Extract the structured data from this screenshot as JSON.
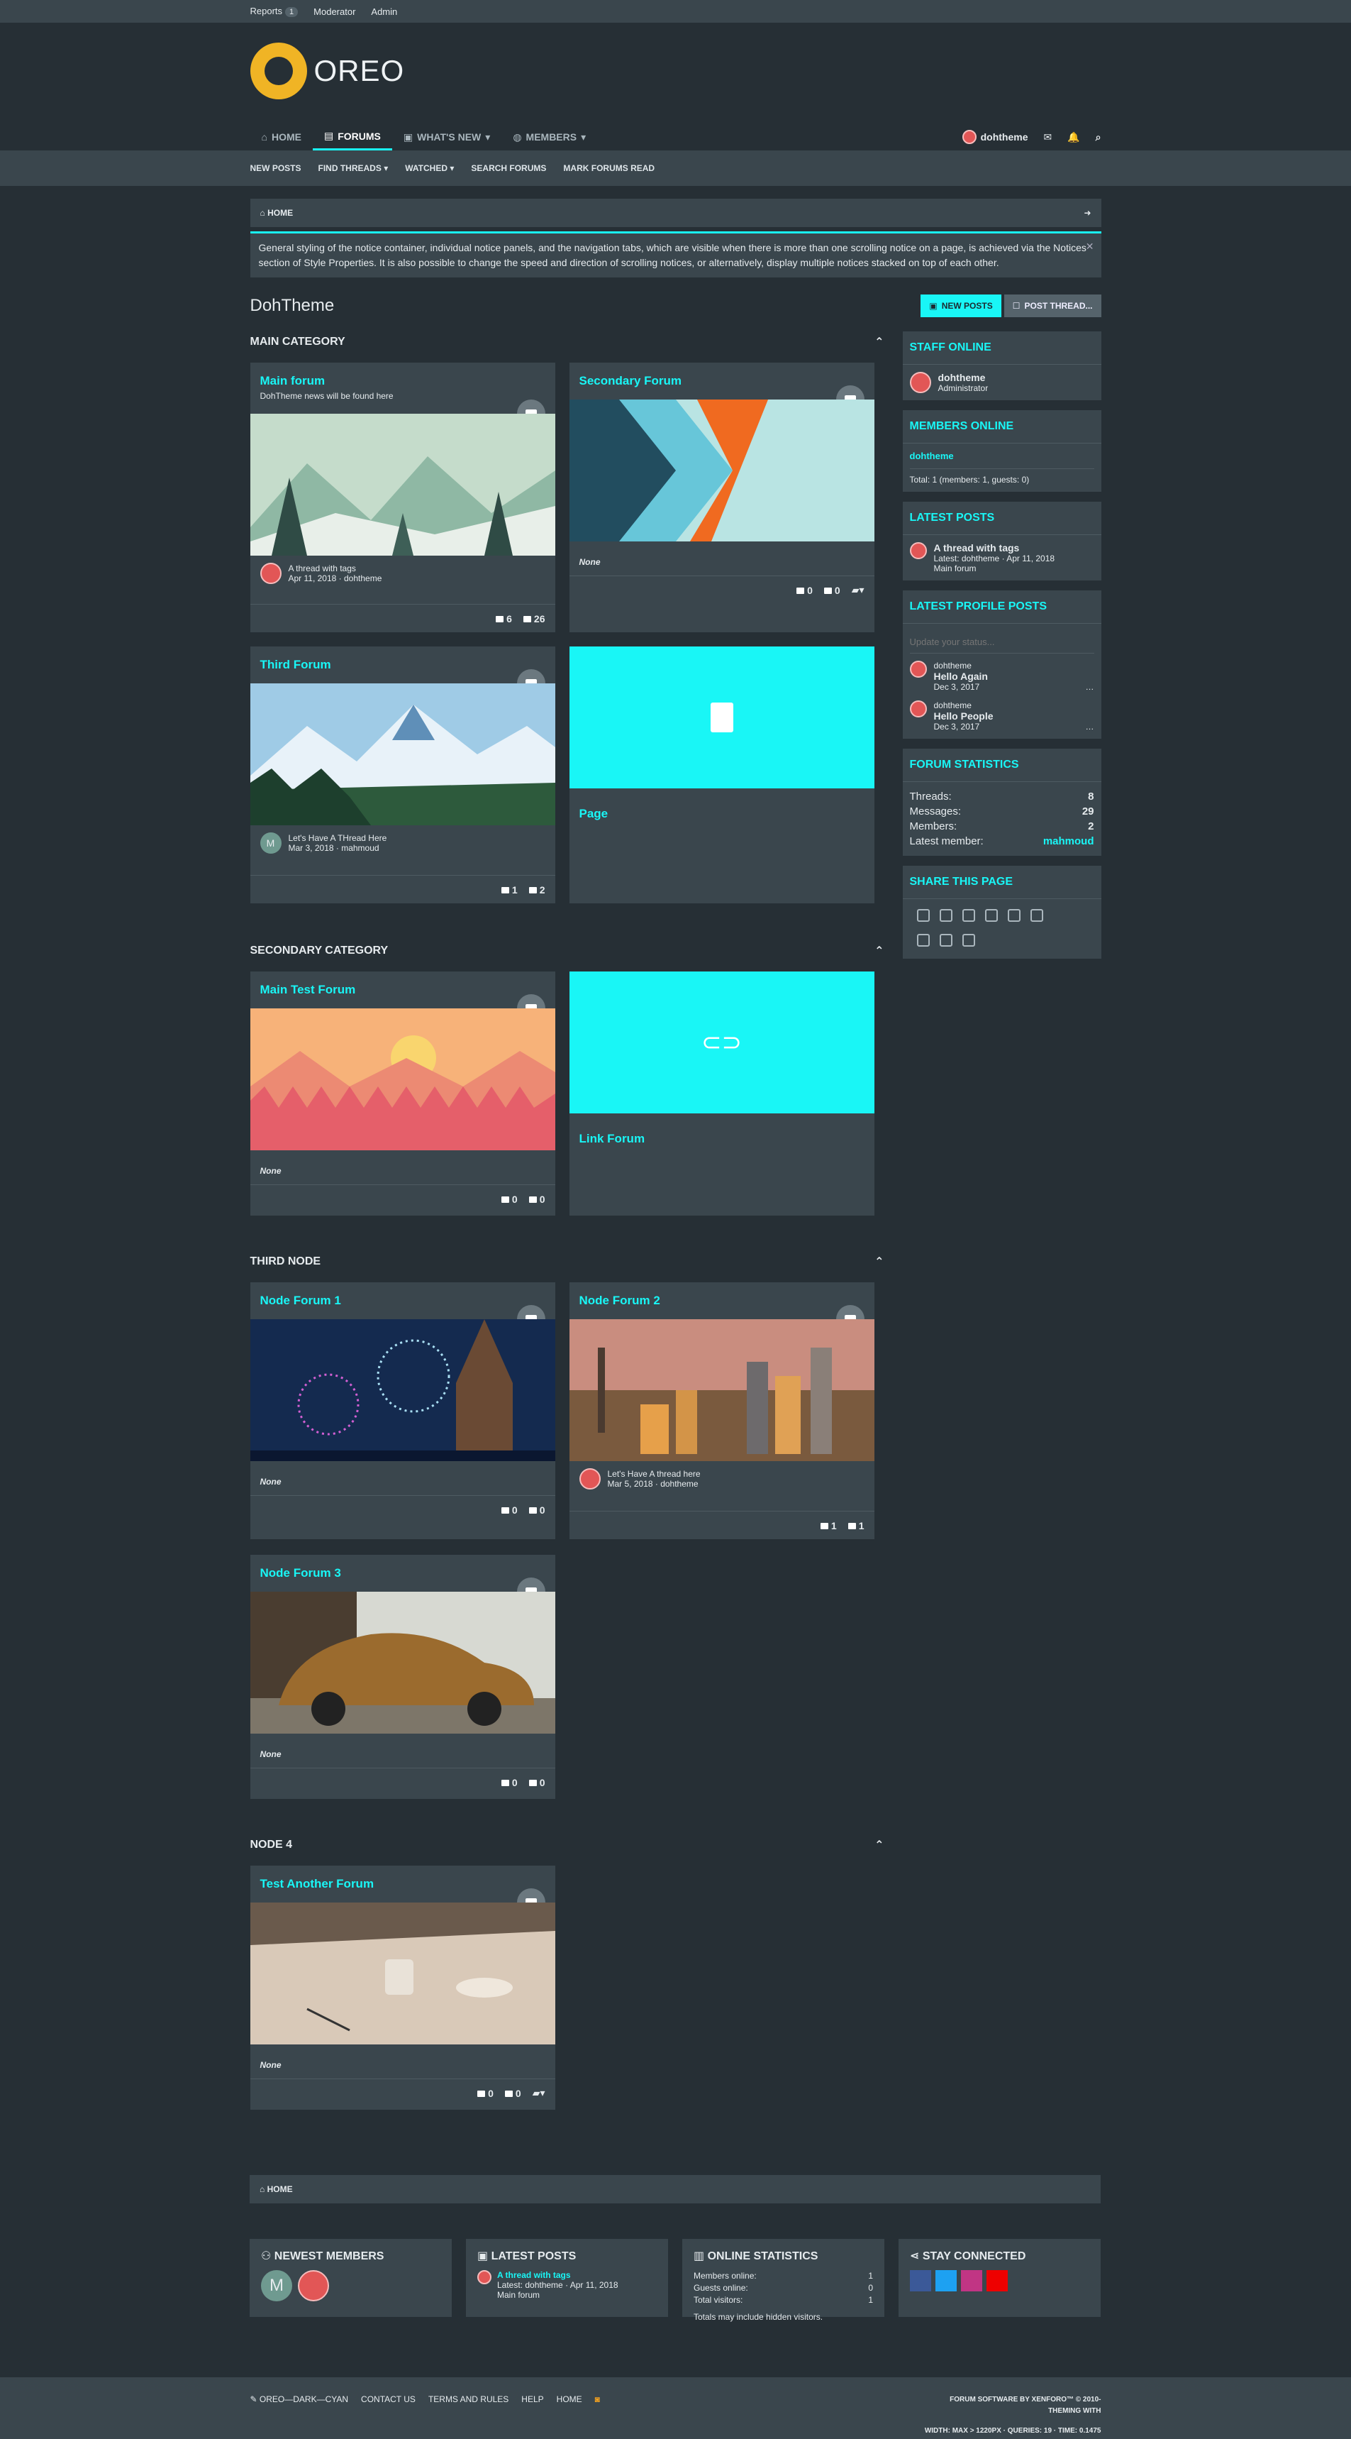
{
  "staffbar": {
    "reports": "Reports",
    "reports_count": "1",
    "moderator": "Moderator",
    "admin": "Admin"
  },
  "brand": {
    "name": "OREO"
  },
  "nav": {
    "home": "HOME",
    "forums": "FORUMS",
    "whats_new": "WHAT'S NEW",
    "members": "MEMBERS",
    "user": "dohtheme"
  },
  "subnav": {
    "new_posts": "NEW POSTS",
    "find_threads": "FIND THREADS",
    "watched": "WATCHED",
    "search_forums": "SEARCH FORUMS",
    "mark_read": "MARK FORUMS READ"
  },
  "breadcrumb": {
    "home": "HOME"
  },
  "notice": {
    "text": "General styling of the notice container, individual notice panels, and the navigation tabs, which are visible when there is more than one scrolling notice on a page, is achieved via the Notices section of Style Properties. It is also possible to change the speed and direction of scrolling notices, or alternatively, display multiple notices stacked on top of each other."
  },
  "page": {
    "title": "DohTheme",
    "new_posts": "NEW POSTS",
    "post_thread": "POST THREAD..."
  },
  "categories": {
    "main": "MAIN CATEGORY",
    "secondary": "SECONDARY CATEGORY",
    "third": "THIRD NODE",
    "node4": "NODE 4"
  },
  "forums": {
    "main_forum": {
      "title": "Main forum",
      "desc": "DohTheme news will be found here",
      "latest_title": "A thread with tags",
      "latest_meta": "Apr 11, 2018 · dohtheme",
      "threads": "6",
      "messages": "26"
    },
    "secondary_forum": {
      "title": "Secondary Forum",
      "none": "None",
      "threads": "0",
      "messages": "0"
    },
    "third_forum": {
      "title": "Third Forum",
      "latest_title": "Let's Have A THread Here",
      "latest_meta": "Mar 3, 2018 · mahmoud",
      "threads": "1",
      "messages": "2"
    },
    "page": {
      "title": "Page"
    },
    "main_test_forum": {
      "title": "Main Test Forum",
      "none": "None",
      "threads": "0",
      "messages": "0"
    },
    "link_forum": {
      "title": "Link Forum"
    },
    "node_forum_1": {
      "title": "Node Forum 1",
      "none": "None",
      "threads": "0",
      "messages": "0"
    },
    "node_forum_2": {
      "title": "Node Forum 2",
      "latest_title": "Let's Have A thread here",
      "latest_meta": "Mar 5, 2018 · dohtheme",
      "threads": "1",
      "messages": "1"
    },
    "node_forum_3": {
      "title": "Node Forum 3",
      "none": "None",
      "threads": "0",
      "messages": "0"
    },
    "test_another_forum": {
      "title": "Test Another Forum",
      "none": "None",
      "threads": "0",
      "messages": "0"
    }
  },
  "sidebar": {
    "staff_online": {
      "title": "STAFF ONLINE",
      "user": "dohtheme",
      "role": "Administrator"
    },
    "members_online": {
      "title": "MEMBERS ONLINE",
      "user": "dohtheme",
      "total": "Total: 1 (members: 1, guests: 0)"
    },
    "latest_posts": {
      "title": "LATEST POSTS",
      "thread": "A thread with tags",
      "meta": "Latest: dohtheme · Apr 11, 2018",
      "forum": "Main forum"
    },
    "latest_profile_posts": {
      "title": "LATEST PROFILE POSTS",
      "placeholder": "Update your status...",
      "post1_user": "dohtheme",
      "post1_text": "Hello Again",
      "post1_date": "Dec 3, 2017",
      "post2_user": "dohtheme",
      "post2_text": "Hello People",
      "post2_date": "Dec 3, 2017"
    },
    "forum_statistics": {
      "title": "FORUM STATISTICS",
      "threads_label": "Threads:",
      "threads": "8",
      "messages_label": "Messages:",
      "messages": "29",
      "members_label": "Members:",
      "members": "2",
      "latest_label": "Latest member:",
      "latest": "mahmoud"
    },
    "share": {
      "title": "SHARE THIS PAGE"
    }
  },
  "footer": {
    "home": "HOME",
    "newest_members": "NEWEST MEMBERS",
    "latest_posts": "LATEST POSTS",
    "latest_thread": "A thread with tags",
    "latest_meta": "Latest: dohtheme · Apr 11, 2018",
    "latest_forum": "Main forum",
    "online_statistics": "ONLINE STATISTICS",
    "members_online_label": "Members online:",
    "members_online": "1",
    "guests_online_label": "Guests online:",
    "guests_online": "0",
    "total_visitors_label": "Total visitors:",
    "total_visitors": "1",
    "hidden_note": "Totals may include hidden visitors.",
    "stay_connected": "STAY CONNECTED",
    "style": "OREO—DARK—CYAN",
    "contact": "CONTACT US",
    "terms": "TERMS AND RULES",
    "help": "HELP",
    "home_link": "HOME",
    "software": "FORUM SOFTWARE BY XENFORO™ © 2010-",
    "theming": "THEMING WITH",
    "debug": "WIDTH: MAX > 1220PX · QUERIES: 19 · TIME: 0.1475"
  },
  "colors": {
    "accent": "#19f6f6",
    "bg": "#262f35",
    "panel": "#3a464d"
  }
}
